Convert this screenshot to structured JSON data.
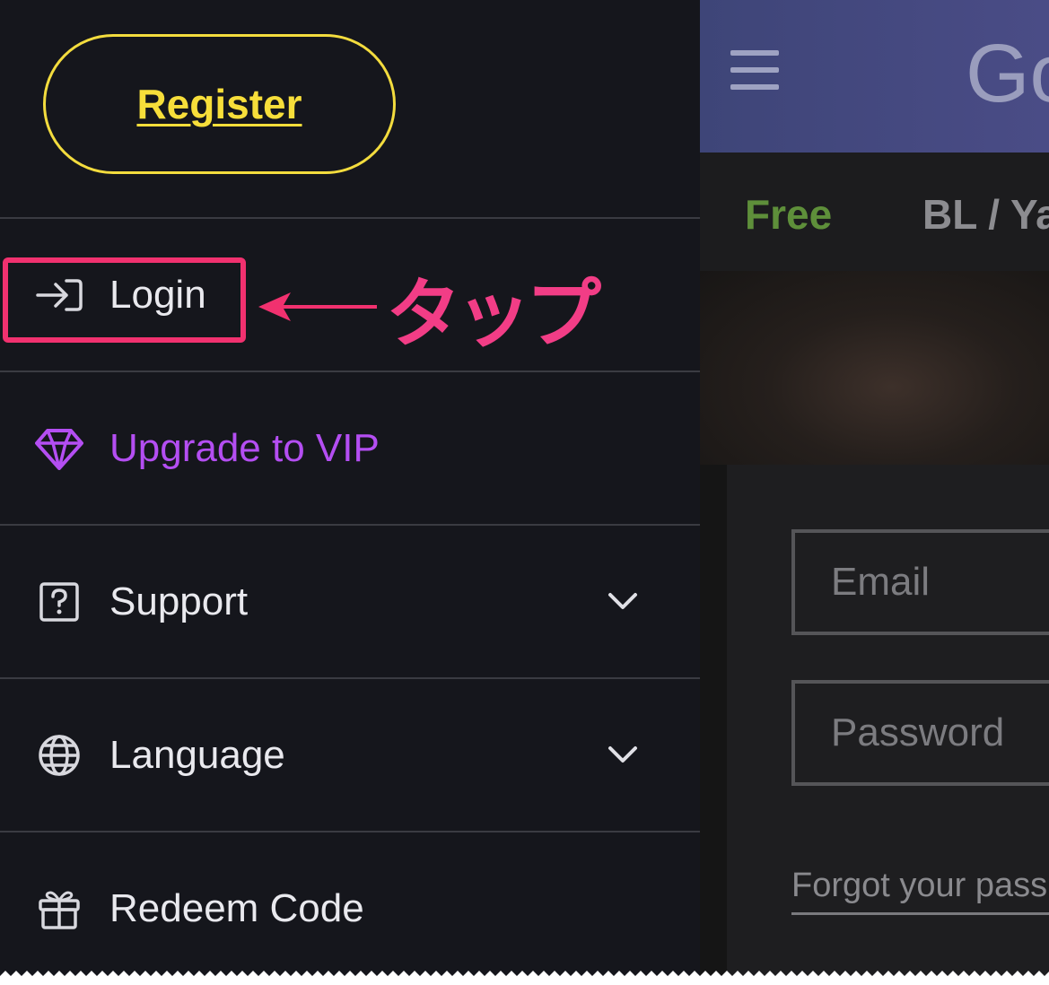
{
  "drawer": {
    "register_label": "Register",
    "items": [
      {
        "label": "Login",
        "icon": "login-arrow-icon"
      },
      {
        "label": "Upgrade to VIP",
        "icon": "diamond-icon",
        "color": "#b44ef2"
      },
      {
        "label": "Support",
        "icon": "question-square-icon",
        "chevron": "chevron-down-icon"
      },
      {
        "label": "Language",
        "icon": "globe-icon",
        "chevron": "chevron-down-icon"
      },
      {
        "label": "Redeem Code",
        "icon": "gift-icon"
      }
    ]
  },
  "annotation": {
    "text": "タップ",
    "color": "#f23d86"
  },
  "background_page": {
    "brand_partial": "Go",
    "tabs": [
      {
        "label": "Free",
        "color": "#5e8f3a"
      },
      {
        "label": "BL / Ya"
      }
    ],
    "email_placeholder": "Email",
    "password_placeholder": "Password",
    "forgot_link": "Forgot your pass"
  },
  "colors": {
    "accent_yellow": "#f3dc3e",
    "vip_purple": "#b44ef2",
    "highlight_pink": "#f1316f"
  }
}
